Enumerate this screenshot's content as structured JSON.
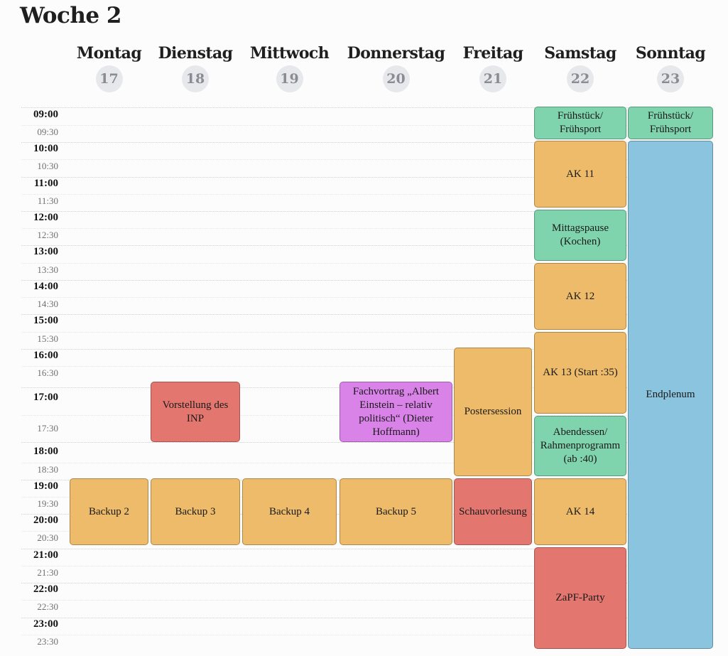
{
  "page_title": "Woche 2",
  "days": [
    {
      "name": "Montag",
      "date": "17"
    },
    {
      "name": "Dienstag",
      "date": "18"
    },
    {
      "name": "Mittwoch",
      "date": "19"
    },
    {
      "name": "Donnerstag",
      "date": "20"
    },
    {
      "name": "Freitag",
      "date": "21"
    },
    {
      "name": "Samstag",
      "date": "22"
    },
    {
      "name": "Sonntag",
      "date": "23"
    }
  ],
  "times": [
    "09:00",
    "09:30",
    "10:00",
    "10:30",
    "11:00",
    "11:30",
    "12:00",
    "12:30",
    "13:00",
    "13:30",
    "14:00",
    "14:30",
    "15:00",
    "15:30",
    "16:00",
    "16:30",
    "17:00",
    "17:30",
    "18:00",
    "18:30",
    "19:00",
    "19:30",
    "20:00",
    "20:30",
    "21:00",
    "21:30",
    "22:00",
    "22:30",
    "23:00",
    "23:30"
  ],
  "events": {
    "vorstellung_inp": "Vorstellung des INP",
    "fachvortrag": "Fachvortrag „Albert Einstein – relativ politisch“ (Dieter Hoffmann)",
    "postersession": "Postersession",
    "backup2": "Backup 2",
    "backup3": "Backup 3",
    "backup4": "Backup 4",
    "backup5": "Backup 5",
    "schauvorlesung": "Schauvorlesung",
    "sa_fruehstueck": "Frühstück/ Frühsport",
    "ak11": "AK 11",
    "mittagspause": "Mittagspause (Kochen)",
    "ak12": "AK 12",
    "ak13": "AK 13 (Start :35)",
    "abendessen": "Abendessen/ Rahmenprogramm (ab :40)",
    "ak14": "AK 14",
    "zapf_party": "ZaPF-Party",
    "so_fruehstueck": "Frühstück/ Frühsport",
    "endplenum": "Endplenum"
  },
  "colors": {
    "orange": "#edbb69",
    "green": "#7fd3ad",
    "red": "#e3776f",
    "purple": "#d983e8",
    "blue": "#8bc4de"
  }
}
